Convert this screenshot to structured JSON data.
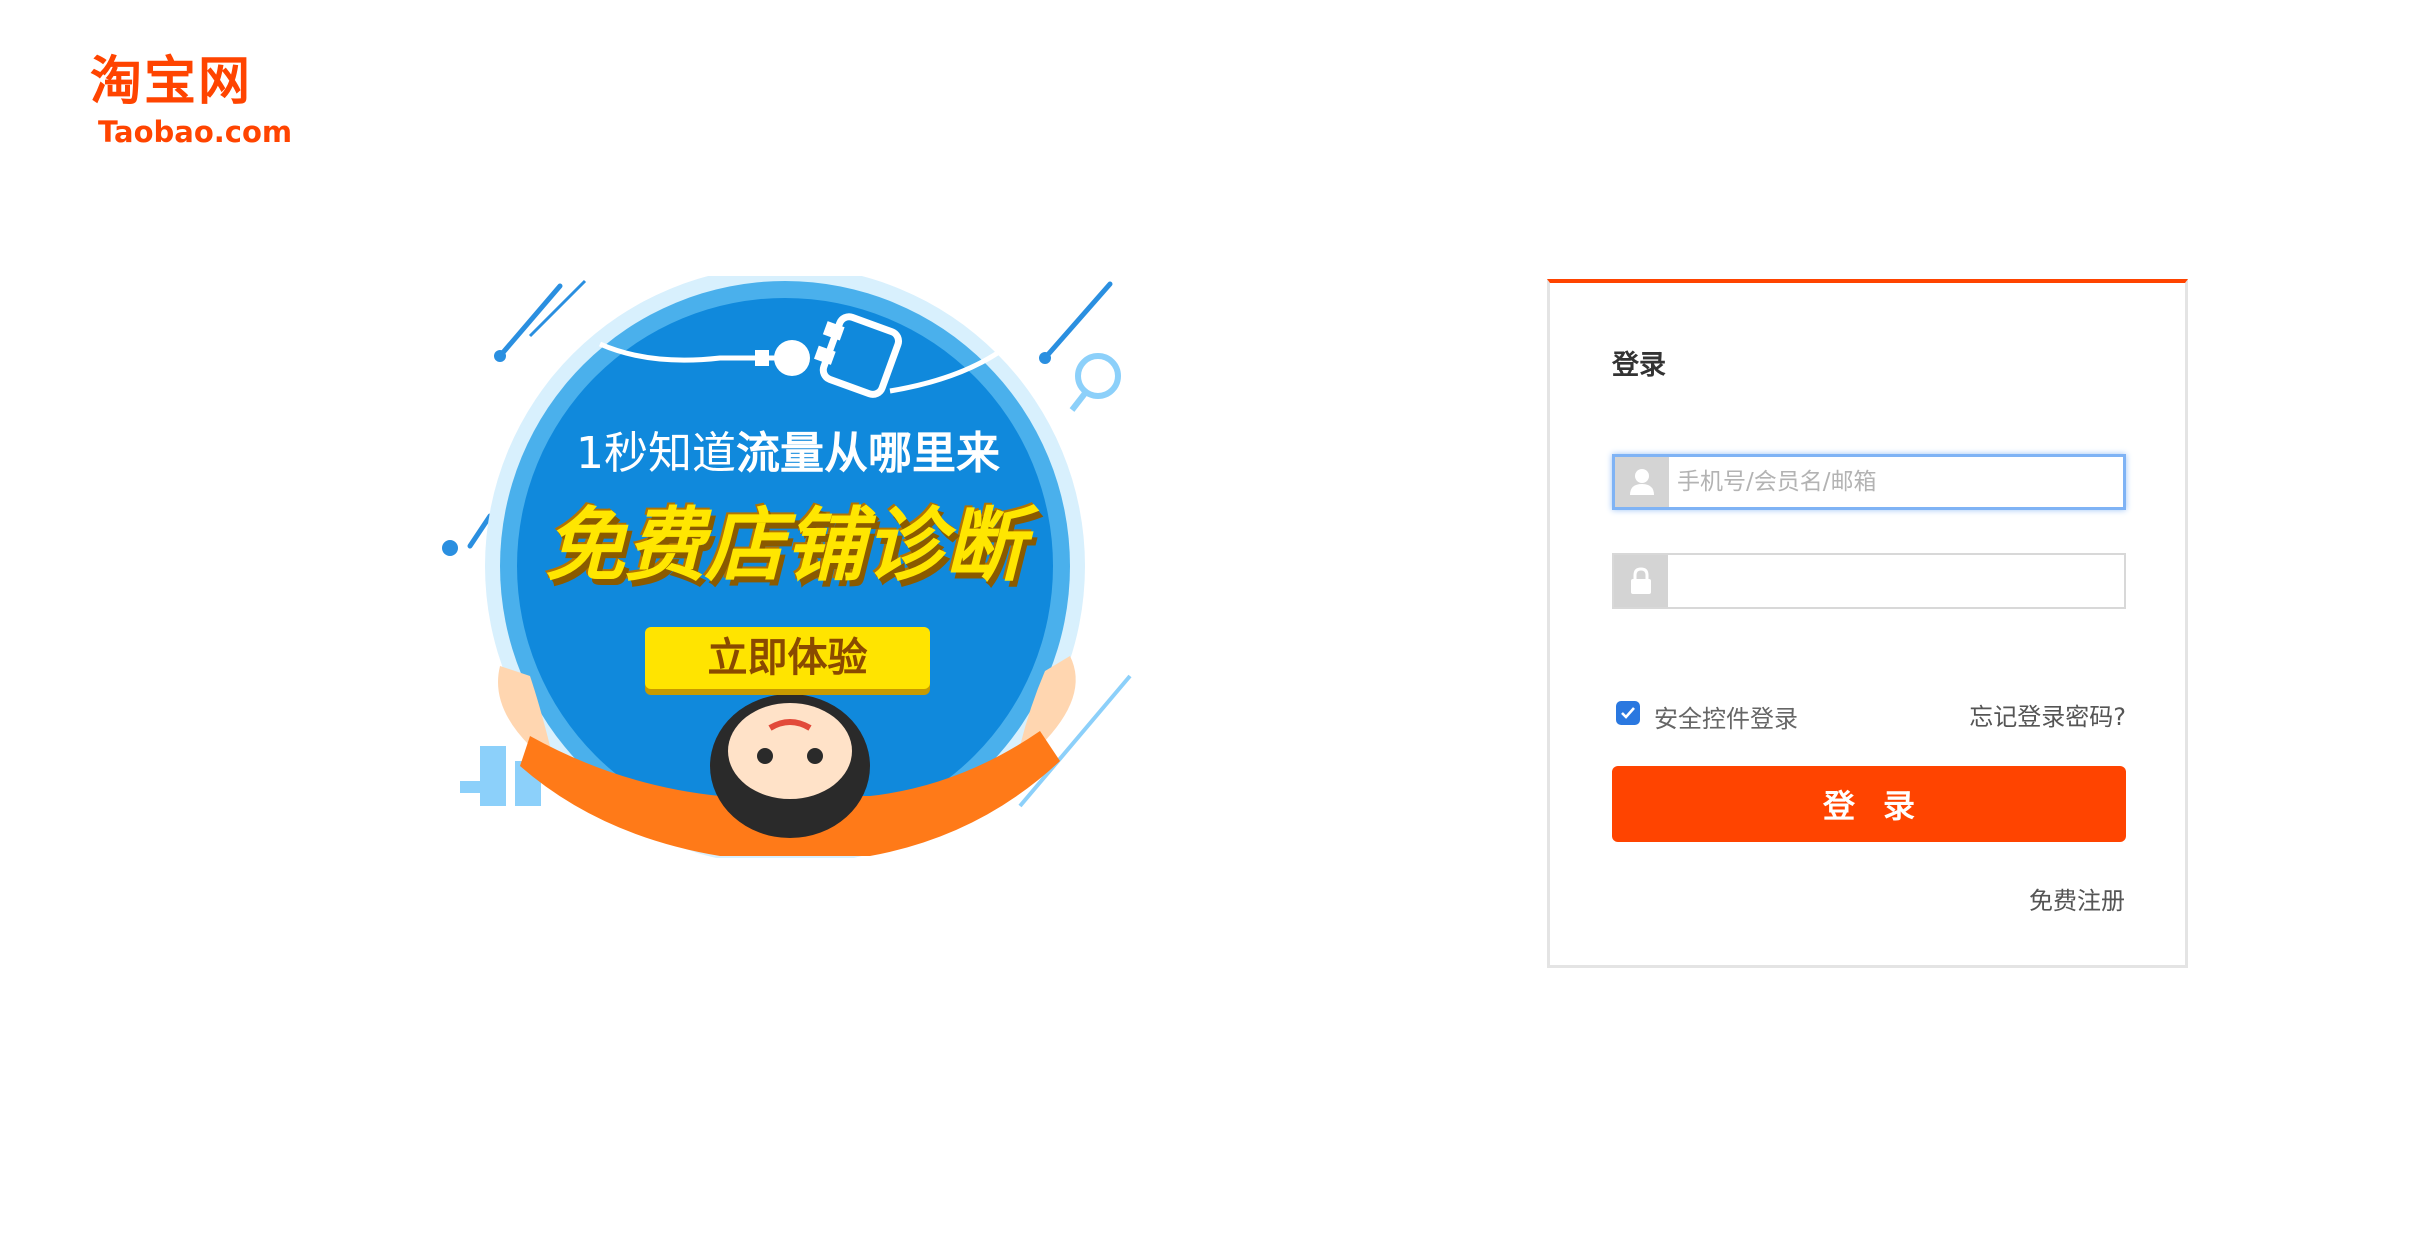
{
  "logo": {
    "cn_text": "淘宝网",
    "en_text": "Taobao.com"
  },
  "promo": {
    "line1_light": "1秒知道",
    "line1_bold": "流量从哪里来",
    "headline": "免费店铺诊断",
    "cta_label": "立即体验"
  },
  "login": {
    "title": "登录",
    "username_placeholder": "手机号/会员名/邮箱",
    "username_value": "",
    "password_value": "",
    "secure_control_label": "安全控件登录",
    "secure_control_checked": true,
    "forgot_password": "忘记登录密码?",
    "submit_label": "登录",
    "register": "免费注册"
  },
  "colors": {
    "brand": "#ff4400",
    "focus": "#7fb3f5",
    "checkbox": "#2a78e0"
  },
  "icons": {
    "user": "user-icon",
    "lock": "lock-icon",
    "check": "check-icon"
  }
}
